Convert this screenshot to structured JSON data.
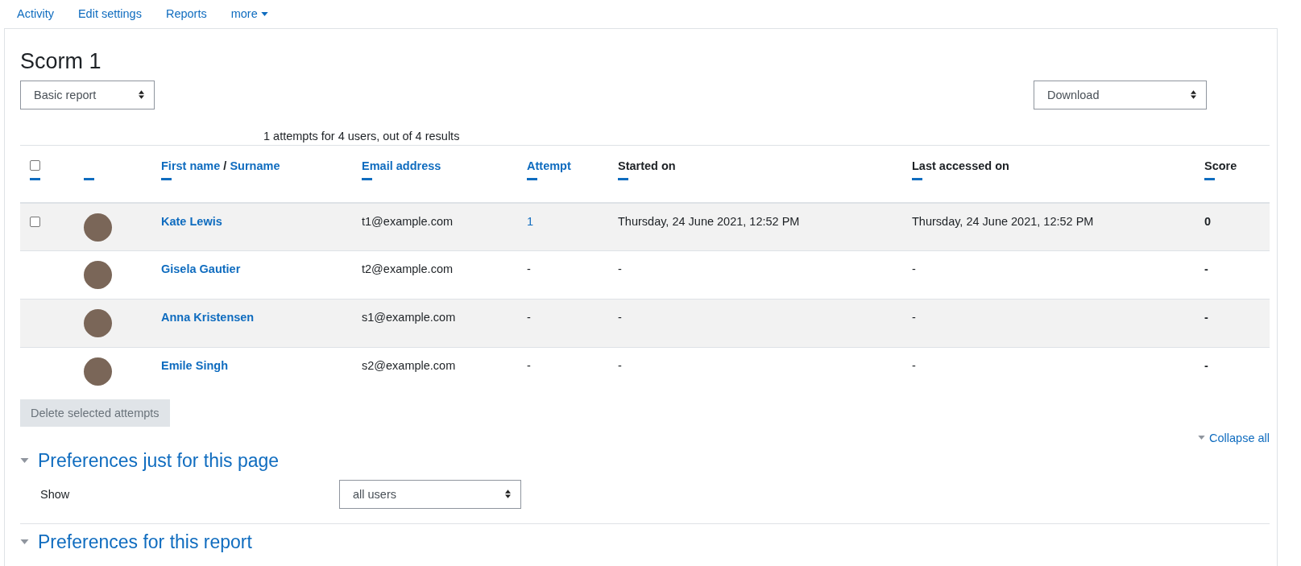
{
  "nav": [
    {
      "label": "Activity",
      "dropdown": false
    },
    {
      "label": "Edit settings",
      "dropdown": false
    },
    {
      "label": "Reports",
      "dropdown": false
    },
    {
      "label": "more",
      "dropdown": true
    }
  ],
  "title": "Scorm 1",
  "report_select": {
    "value": "Basic report"
  },
  "download_select": {
    "value": "Download"
  },
  "summary": "1 attempts for 4 users, out of 4 results",
  "table": {
    "columns": [
      {
        "kind": "checkbox",
        "checked": false
      },
      {
        "kind": "blank"
      },
      {
        "kind": "links",
        "labels": [
          "First name",
          "Surname"
        ],
        "separator": "/"
      },
      {
        "kind": "link",
        "label": "Email address"
      },
      {
        "kind": "link",
        "label": "Attempt"
      },
      {
        "kind": "plain",
        "label": "Started on"
      },
      {
        "kind": "plain",
        "label": "Last accessed on"
      },
      {
        "kind": "plain",
        "label": "Score"
      }
    ],
    "rows": [
      {
        "checkbox": {
          "checked": false
        },
        "name": "Kate Lewis",
        "email": "t1@example.com",
        "attempt": "1",
        "attempt_link": true,
        "started": "Thursday, 24 June 2021, 12:52 PM",
        "last_accessed": "Thursday, 24 June 2021, 12:52 PM",
        "score": "0"
      },
      {
        "name": "Gisela Gautier",
        "email": "t2@example.com",
        "attempt": "-",
        "attempt_link": false,
        "started": "-",
        "last_accessed": "-",
        "score": "-"
      },
      {
        "name": "Anna Kristensen",
        "email": "s1@example.com",
        "attempt": "-",
        "attempt_link": false,
        "started": "-",
        "last_accessed": "-",
        "score": "-"
      },
      {
        "name": "Emile Singh",
        "email": "s2@example.com",
        "attempt": "-",
        "attempt_link": false,
        "started": "-",
        "last_accessed": "-",
        "score": "-"
      }
    ]
  },
  "delete_button": {
    "label": "Delete selected attempts",
    "disabled": true
  },
  "collapse_all": "Collapse all",
  "sections": [
    {
      "title": "Preferences just for this page",
      "expanded": true,
      "fields": [
        {
          "label": "Show",
          "value": "all users"
        }
      ]
    },
    {
      "title": "Preferences for this report",
      "expanded": true
    }
  ]
}
